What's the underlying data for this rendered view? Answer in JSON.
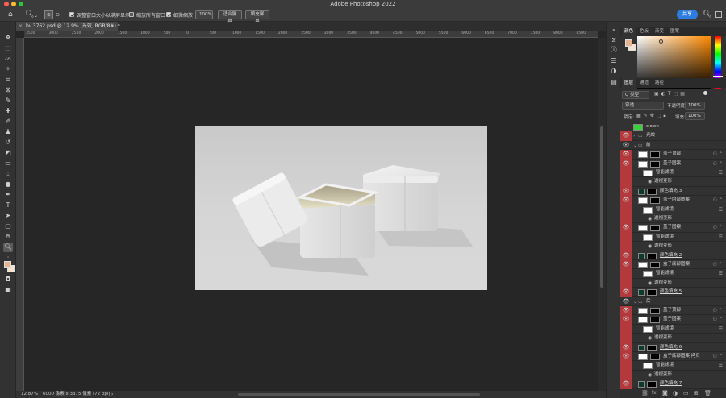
{
  "app": {
    "title": "Adobe Photoshop 2022"
  },
  "options": {
    "resize_windows": "调整窗口大小以满屏显示",
    "zoom_all": "缩放所有窗口",
    "scrubby_zoom": "细微缩放",
    "zoom_percent": "100%",
    "fit_screen": "适合屏幕",
    "fill_screen": "填充屏幕",
    "share": "共享"
  },
  "document": {
    "tab": "bv.3762.psd @ 12.9% (光效, RGB/8#) *",
    "ruler_ticks": [
      "3500",
      "3000",
      "2500",
      "2000",
      "1500",
      "1000",
      "500",
      "0",
      "500",
      "1000",
      "1500",
      "2000",
      "2500",
      "3000",
      "3500",
      "4000",
      "4500",
      "5000",
      "5500",
      "6000",
      "6500",
      "7000",
      "7500",
      "8000",
      "8500"
    ],
    "status_zoom": "12.87%",
    "status_info": "6000 像素 x 3375 像素 (72 ppi)"
  },
  "colors": {
    "accent": "#2d7de0",
    "layer_red": "#b4393d",
    "foreground": "#e8b48f",
    "background": "#f6e2cf"
  },
  "panels": {
    "color_tabs": [
      "颜色",
      "色板",
      "渐变",
      "图案"
    ],
    "layer_tabs": [
      "图层",
      "通道",
      "路径"
    ],
    "filter_kind": "Q 类型",
    "blend_mode": "穿透",
    "opacity_label": "不透明度:",
    "opacity_value": "100%",
    "lock_label": "锁定:",
    "fill_label": "填充:",
    "fill_value": "100%"
  },
  "layers": [
    {
      "name": "clown",
      "kind": "group-green",
      "red": false,
      "indent": 0
    },
    {
      "name": "光效",
      "kind": "folder",
      "red": true,
      "indent": 0
    },
    {
      "name": "前",
      "kind": "folder-open",
      "red": false,
      "indent": 0
    },
    {
      "name": "盖子顶部",
      "kind": "smart",
      "red": true,
      "indent": 1
    },
    {
      "name": "盖子图案",
      "kind": "smart",
      "red": true,
      "indent": 1
    },
    {
      "name": "智能滤镜",
      "kind": "filter",
      "red": true,
      "indent": 2
    },
    {
      "name": "透视变形",
      "kind": "effect",
      "red": true,
      "indent": 3
    },
    {
      "name": "颜色填充 3",
      "kind": "fill",
      "red": true,
      "indent": 1
    },
    {
      "name": "盖子内部图案",
      "kind": "smart",
      "red": true,
      "indent": 1
    },
    {
      "name": "智能滤镜",
      "kind": "filter",
      "red": true,
      "indent": 2
    },
    {
      "name": "透视变形",
      "kind": "effect",
      "red": true,
      "indent": 3
    },
    {
      "name": "盖子图案",
      "kind": "smart",
      "red": true,
      "indent": 1
    },
    {
      "name": "智能滤镜",
      "kind": "filter",
      "red": true,
      "indent": 2
    },
    {
      "name": "透视变形",
      "kind": "effect",
      "red": true,
      "indent": 3
    },
    {
      "name": "颜色填充 2",
      "kind": "fill",
      "red": true,
      "indent": 1
    },
    {
      "name": "盒子底部图案",
      "kind": "smart",
      "red": true,
      "indent": 1
    },
    {
      "name": "智能滤镜",
      "kind": "filter",
      "red": true,
      "indent": 2
    },
    {
      "name": "透视变形",
      "kind": "effect",
      "red": true,
      "indent": 3
    },
    {
      "name": "颜色填充 5",
      "kind": "fill",
      "red": true,
      "indent": 1
    },
    {
      "name": "后",
      "kind": "folder-open",
      "red": false,
      "indent": 0
    },
    {
      "name": "盖子顶部",
      "kind": "smart",
      "red": true,
      "indent": 1
    },
    {
      "name": "盖子图案",
      "kind": "smart",
      "red": true,
      "indent": 1
    },
    {
      "name": "智能滤镜",
      "kind": "filter",
      "red": true,
      "indent": 2
    },
    {
      "name": "透视变形",
      "kind": "effect",
      "red": true,
      "indent": 3
    },
    {
      "name": "颜色填充 6",
      "kind": "fill",
      "red": true,
      "indent": 1
    },
    {
      "name": "盒子底部图案 拷贝",
      "kind": "smart",
      "red": true,
      "indent": 1
    },
    {
      "name": "智能滤镜",
      "kind": "filter",
      "red": true,
      "indent": 2
    },
    {
      "name": "透视变形",
      "kind": "effect",
      "red": true,
      "indent": 3
    },
    {
      "name": "颜色填充 7",
      "kind": "fill",
      "red": true,
      "indent": 1
    }
  ]
}
